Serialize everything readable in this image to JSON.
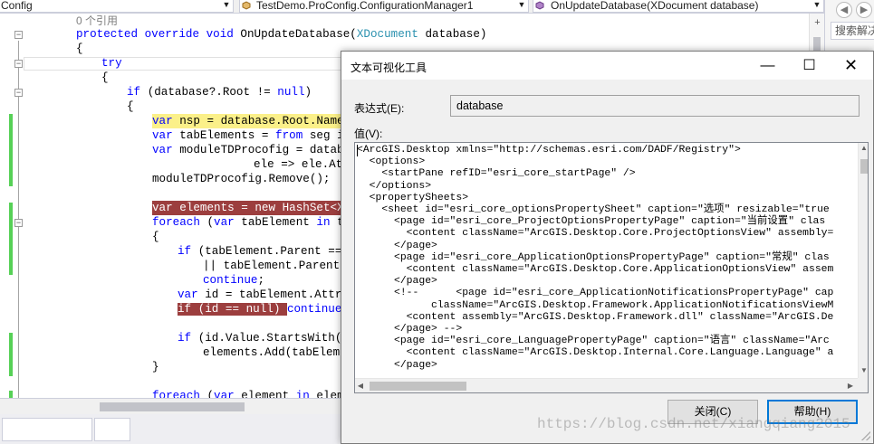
{
  "navbar": {
    "project_combo": "Config",
    "class_combo": "TestDemo.ProConfig.ConfigurationManager1",
    "member_combo": "OnUpdateDatabase(XDocument database)"
  },
  "right_panel": {
    "search_placeholder": "搜索解决"
  },
  "code": {
    "reference_count": "0 个引用",
    "lines": [
      {
        "kw": "protected override void ",
        "text": "OnUpdateDatabase(",
        "type": "XDocument",
        "rest": " database)"
      },
      {
        "text": "{"
      },
      {
        "kw": "try"
      },
      {
        "text": "{"
      },
      {
        "kw": "if ",
        "text": "(database?.Root != ",
        "kw2": "null",
        "rest": ")"
      },
      {
        "text": "{"
      },
      {
        "kw": "var ",
        "text": "nsp = database.Root.Name.N"
      },
      {
        "kw": "var ",
        "text": "tabElements = ",
        "kw2": "from ",
        "rest": "seg in"
      },
      {
        "kw": "var ",
        "text": "moduleTDProcofig = databas"
      },
      {
        "text": "ele => ele.Att"
      },
      {
        "text": "moduleTDProcofig.Remove();"
      },
      {
        "kw": "var ",
        "text": "elements = ",
        "kw2": "new ",
        "rest": "HashSet<XEl"
      },
      {
        "kw": "foreach ",
        "text": "(",
        "kw2": "var ",
        "rest": "tabElement ",
        "kw3": "in ",
        "rest2": "tab"
      },
      {
        "text": "{"
      },
      {
        "kw": "if ",
        "text": "(tabElement.Parent == n"
      },
      {
        "text": "|| tabElement.Parent.N"
      },
      {
        "kw": "continue",
        "text": ";"
      },
      {
        "kw": "var ",
        "text": "id = tabElement.Attrib"
      },
      {
        "kw": "if ",
        "text": "(id == null) ",
        "kw2": "continue",
        "rest": ";"
      },
      {
        "kw": "if ",
        "text": "(id.Value.StartsWith(\"e"
      },
      {
        "text": "elements.Add(tabElemen"
      },
      {
        "text": "}"
      },
      {
        "kw": "foreach ",
        "text": "(",
        "kw2": "var ",
        "rest": "element ",
        "kw3": "in ",
        "rest2": "elemen"
      }
    ]
  },
  "dialog": {
    "title": "文本可视化工具",
    "expression_label": "表达式(E):",
    "expression_value": "database",
    "value_label": "值(V):",
    "xml_lines": [
      "<ArcGIS.Desktop xmlns=\"http://schemas.esri.com/DADF/Registry\">",
      "  <options>",
      "    <startPane refID=\"esri_core_startPage\" />",
      "  </options>",
      "  <propertySheets>",
      "    <sheet id=\"esri_core_optionsPropertySheet\" caption=\"选项\" resizable=\"true",
      "      <page id=\"esri_core_ProjectOptionsPropertyPage\" caption=\"当前设置\" clas",
      "        <content className=\"ArcGIS.Desktop.Core.ProjectOptionsView\" assembly=",
      "      </page>",
      "      <page id=\"esri_core_ApplicationOptionsPropertyPage\" caption=\"常规\" clas",
      "        <content className=\"ArcGIS.Desktop.Core.ApplicationOptionsView\" assem",
      "      </page>",
      "      <!--      <page id=\"esri_core_ApplicationNotificationsPropertyPage\" cap",
      "            className=\"ArcGIS.Desktop.Framework.ApplicationNotificationsViewM",
      "        <content assembly=\"ArcGIS.Desktop.Framework.dll\" className=\"ArcGIS.De",
      "      </page> -->",
      "      <page id=\"esri_core_LanguagePropertyPage\" caption=\"语言\" className=\"Arc",
      "        <content className=\"ArcGIS.Desktop.Internal.Core.Language.Language\" a",
      "      </page>"
    ],
    "close_button": "关闭(C)",
    "help_button": "帮助(H)"
  },
  "watermark": "https://blog.csdn.net/xiangqiang2015",
  "colors": {
    "keyword": "#0000ff",
    "type": "#2b91af",
    "highlight_yellow": "#fbf089",
    "highlight_red": "#9c3e3e",
    "change_bar": "#57d157"
  }
}
